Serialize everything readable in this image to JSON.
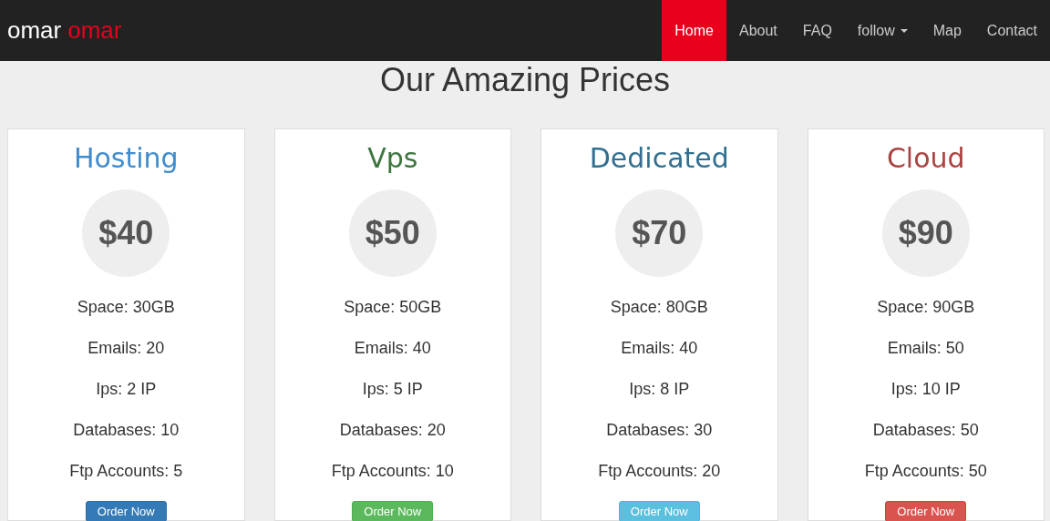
{
  "navbar": {
    "brand": [
      "omar",
      "omar"
    ],
    "items": [
      {
        "label": "Home",
        "selected": true,
        "kind": "link"
      },
      {
        "label": "About",
        "selected": false,
        "kind": "link"
      },
      {
        "label": "FAQ",
        "selected": false,
        "kind": "link"
      },
      {
        "label": "follow",
        "selected": false,
        "kind": "dropdown"
      },
      {
        "label": "Map",
        "selected": false,
        "kind": "link"
      },
      {
        "label": "Contact",
        "selected": false,
        "kind": "link"
      }
    ]
  },
  "heading": "Our Amazing Prices",
  "plans": [
    {
      "title": "Hosting",
      "color": "#428bca",
      "price": "$40",
      "features": [
        "Space: 30GB",
        "Emails: 20",
        "Ips: 2 IP",
        "Databases: 10",
        "Ftp Accounts: 5"
      ],
      "button": {
        "label": "Order Now",
        "kind": "primary"
      }
    },
    {
      "title": "Vps",
      "color": "#3c763d",
      "price": "$50",
      "features": [
        "Space: 50GB",
        "Emails: 40",
        "Ips: 5 IP",
        "Databases: 20",
        "Ftp Accounts: 10"
      ],
      "button": {
        "label": "Order Now",
        "kind": "success"
      }
    },
    {
      "title": "Dedicated",
      "color": "#31708f",
      "price": "$70",
      "features": [
        "Space: 80GB",
        "Emails: 40",
        "Ips: 8 IP",
        "Databases: 30",
        "Ftp Accounts: 20"
      ],
      "button": {
        "label": "Order Now",
        "kind": "info"
      }
    },
    {
      "title": "Cloud",
      "color": "#a94442",
      "price": "$90",
      "features": [
        "Space: 90GB",
        "Emails: 50",
        "Ips: 10 IP",
        "Databases: 50",
        "Ftp Accounts: 50"
      ],
      "button": {
        "label": "Order Now",
        "kind": "danger"
      }
    }
  ]
}
